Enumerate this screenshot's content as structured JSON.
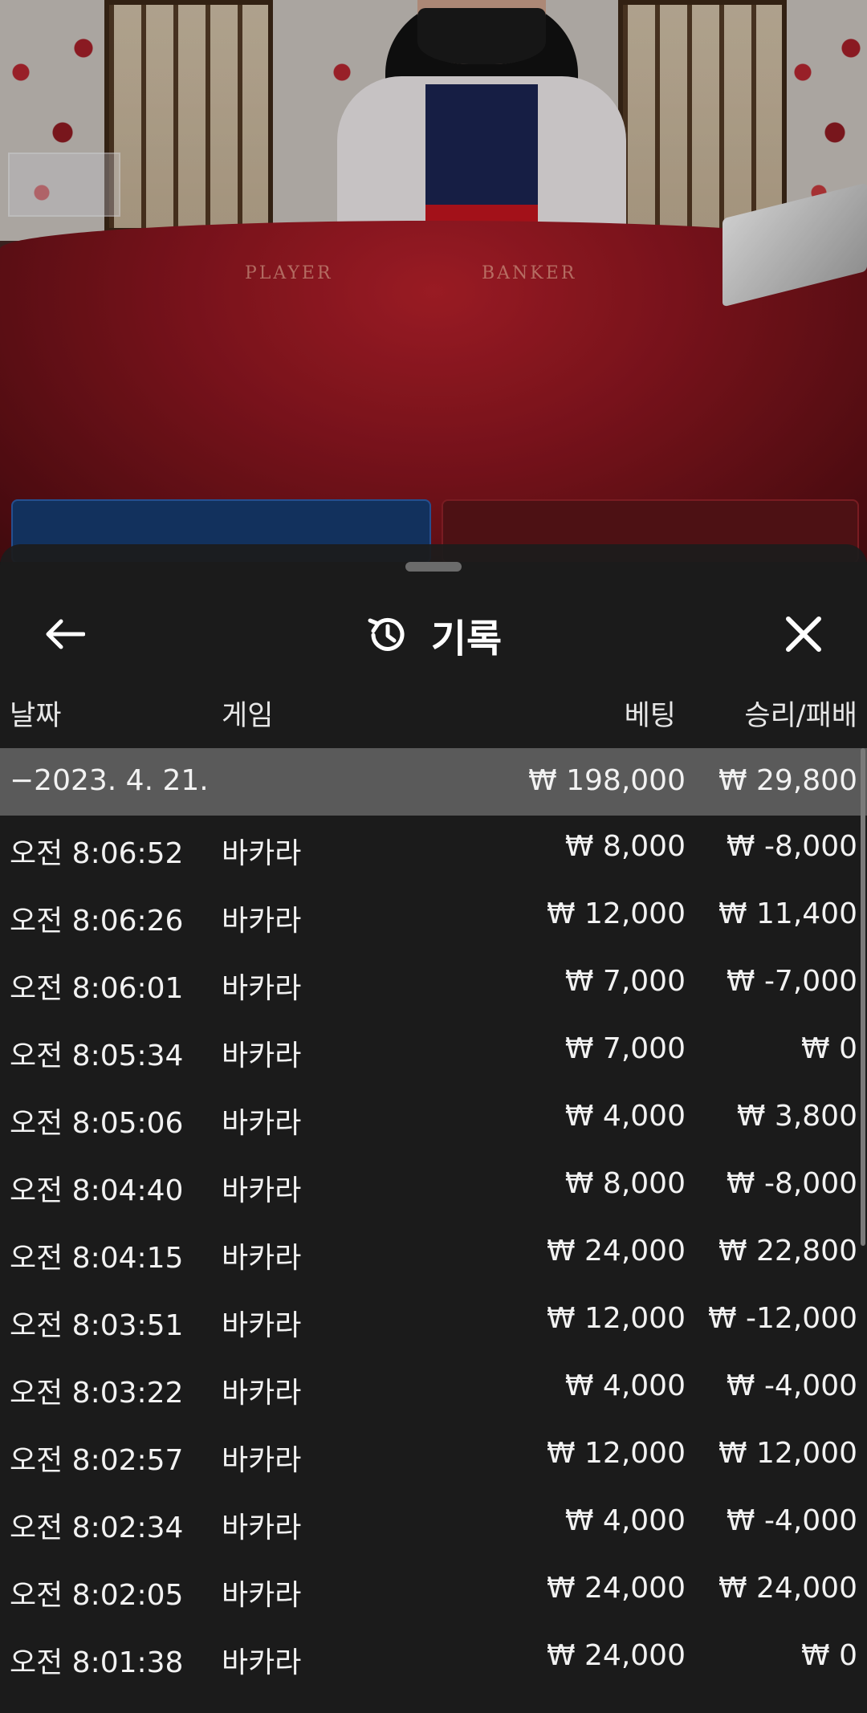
{
  "scene": {
    "felt_player_text": "PLAYER",
    "felt_banker_text": "BANKER"
  },
  "sheet": {
    "title": "기록",
    "icons": {
      "back": "arrow-left-icon",
      "history": "history-icon",
      "close": "close-icon"
    }
  },
  "columns": {
    "date": "날짜",
    "game": "게임",
    "bet": "베팅",
    "result": "승리/패배"
  },
  "day_summary": {
    "date": "−2023. 4. 21.",
    "bet": "₩ 198,000",
    "result": "₩ 29,800"
  },
  "rows": [
    {
      "time": "오전 8:06:52",
      "game": "바카라",
      "bet": "₩ 8,000",
      "result": "₩ -8,000"
    },
    {
      "time": "오전 8:06:26",
      "game": "바카라",
      "bet": "₩ 12,000",
      "result": "₩ 11,400"
    },
    {
      "time": "오전 8:06:01",
      "game": "바카라",
      "bet": "₩ 7,000",
      "result": "₩ -7,000"
    },
    {
      "time": "오전 8:05:34",
      "game": "바카라",
      "bet": "₩ 7,000",
      "result": "₩ 0"
    },
    {
      "time": "오전 8:05:06",
      "game": "바카라",
      "bet": "₩ 4,000",
      "result": "₩ 3,800"
    },
    {
      "time": "오전 8:04:40",
      "game": "바카라",
      "bet": "₩ 8,000",
      "result": "₩ -8,000"
    },
    {
      "time": "오전 8:04:15",
      "game": "바카라",
      "bet": "₩ 24,000",
      "result": "₩ 22,800"
    },
    {
      "time": "오전 8:03:51",
      "game": "바카라",
      "bet": "₩ 12,000",
      "result": "₩ -12,000"
    },
    {
      "time": "오전 8:03:22",
      "game": "바카라",
      "bet": "₩ 4,000",
      "result": "₩ -4,000"
    },
    {
      "time": "오전 8:02:57",
      "game": "바카라",
      "bet": "₩ 12,000",
      "result": "₩ 12,000"
    },
    {
      "time": "오전 8:02:34",
      "game": "바카라",
      "bet": "₩ 4,000",
      "result": "₩ -4,000"
    },
    {
      "time": "오전 8:02:05",
      "game": "바카라",
      "bet": "₩ 24,000",
      "result": "₩ 24,000"
    },
    {
      "time": "오전 8:01:38",
      "game": "바카라",
      "bet": "₩ 24,000",
      "result": "₩ 0"
    }
  ]
}
